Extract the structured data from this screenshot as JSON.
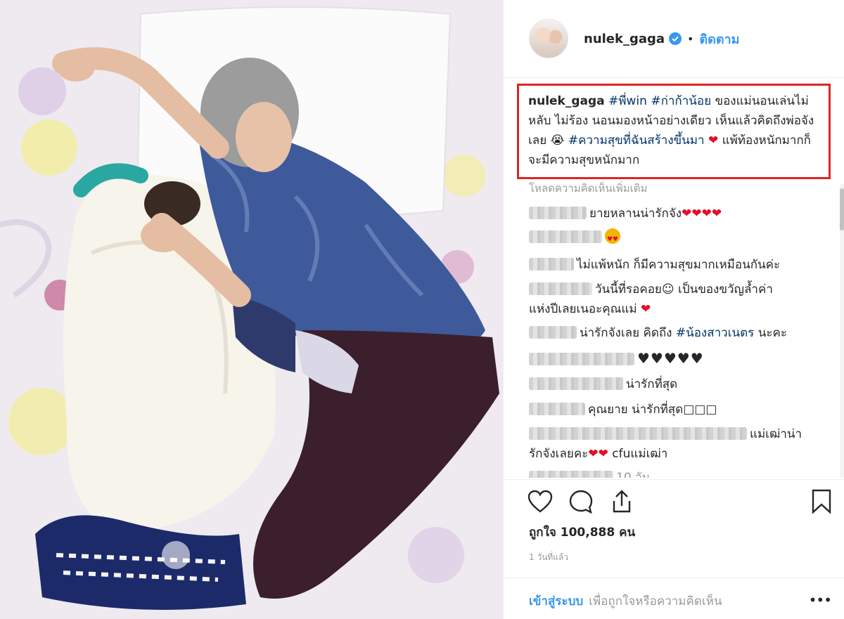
{
  "post": {
    "username": "nulek_gaga",
    "follow_label": "ติดตาม",
    "separator": "•",
    "caption": {
      "username": "nulek_gaga",
      "tag1": "#พี่win",
      "tag2": "#ก่าก้าน้อย",
      "text1": "ของแม่นอนเล่นไม่หลับ ไม่ร้อง นอนมองหน้าอย่างเดียว เห็นแล้วคิดถึงพ่อจังเลย 😭",
      "tag3": "#ความสุขที่ฉันสร้างขึ้นมา",
      "heart": "❤",
      "text2": "แพ้ท้องหนักมากก็จะมีความสุขหนักมาก"
    },
    "load_more": "โหลดความคิดเห็นเพิ่มเติม",
    "comments": [
      {
        "text": "ยายหลานน่ารักจัง",
        "suffix": "❤❤❤❤"
      },
      {
        "text": ""
      },
      {
        "text": "ไม่แพ้หนัก ก็มีความสุขมากเหมือนกันค่ะ"
      },
      {
        "text": "วันนี้ที่รอคอย☺ เป็นของขวัญล้ำค่า",
        "text2": "แห่งปีเลยเนอะคุณแม่",
        "suffix": "❤"
      },
      {
        "text": "น่ารักจังเลย คิดถึง",
        "tag": "#น้องสาวเนตร",
        "after": "นะคะ"
      },
      {
        "text": "♥♥♥♥♥"
      },
      {
        "text": "น่ารักที่สุด"
      },
      {
        "text": "คุณยาย น่ารักที่สุด□□□"
      },
      {
        "text": "แม่เฒ่าน่า",
        "text2": "รักจังเลยคะ",
        "suffix": "❤❤",
        "after": "cfuแม่เฒ่า"
      },
      {
        "text": "10 วัน"
      }
    ],
    "likes": "ถูกใจ 100,888 คน",
    "time": "1 วันที่แล้ว",
    "login_link": "เข้าสู่ระบบ",
    "login_rest": "เพื่อถูกใจหรือความคิดเห็น",
    "options": "•••"
  },
  "colors": {
    "accent": "#3897f0",
    "highlight_border": "#e02424",
    "hashtag": "#003569"
  },
  "icons": [
    "verified-badge-icon",
    "heart-icon",
    "comment-icon",
    "share-icon",
    "bookmark-icon",
    "more-options-icon"
  ]
}
